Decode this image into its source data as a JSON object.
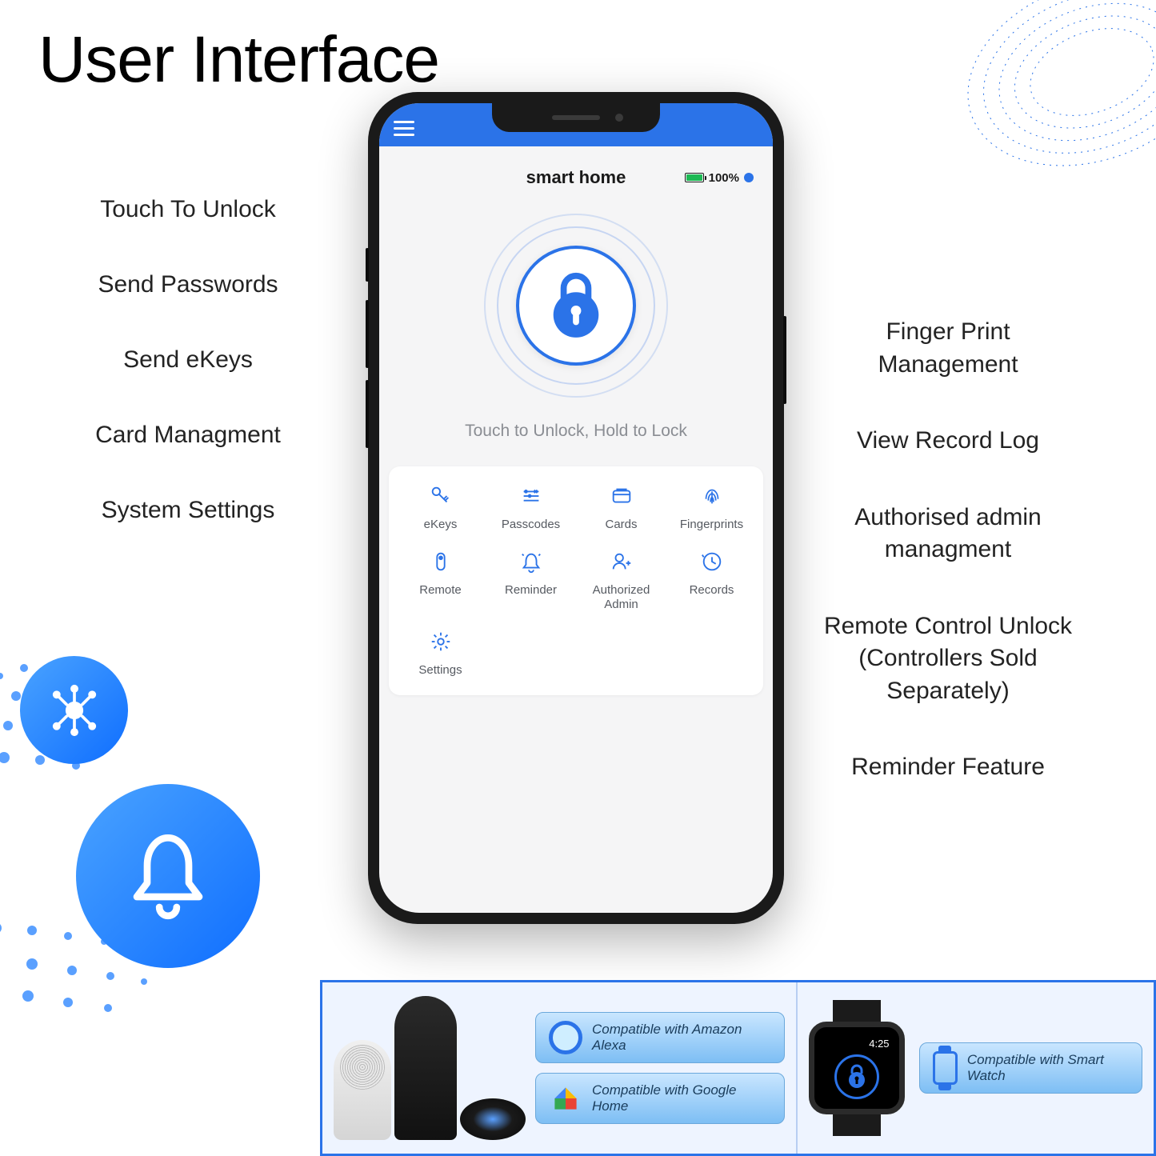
{
  "page": {
    "title": "User Interface"
  },
  "left_features": [
    "Touch To Unlock",
    "Send Passwords",
    "Send eKeys",
    "Card Managment",
    "System Settings"
  ],
  "right_features": [
    "Finger Print Management",
    "View Record Log",
    "Authorised admin managment",
    "Remote Control Unlock (Controllers Sold Separately)",
    "Reminder Feature"
  ],
  "app": {
    "title": "smart home",
    "battery_pct": "100%",
    "lock_hint": "Touch to Unlock, Hold to Lock"
  },
  "grid": [
    {
      "id": "ekeys",
      "label": "eKeys"
    },
    {
      "id": "passcodes",
      "label": "Passcodes"
    },
    {
      "id": "cards",
      "label": "Cards"
    },
    {
      "id": "fingerprints",
      "label": "Fingerprints"
    },
    {
      "id": "remote",
      "label": "Remote"
    },
    {
      "id": "reminder",
      "label": "Reminder"
    },
    {
      "id": "authorized-admin",
      "label": "Authorized Admin"
    },
    {
      "id": "records",
      "label": "Records"
    },
    {
      "id": "settings",
      "label": "Settings"
    }
  ],
  "compat": {
    "alexa": "Compatible with Amazon Alexa",
    "ghome": "Compatible with Google Home",
    "watch": "Compatible with Smart Watch",
    "watch_time": "4:25"
  }
}
